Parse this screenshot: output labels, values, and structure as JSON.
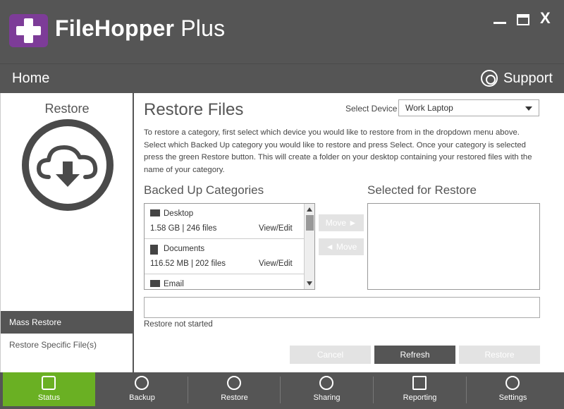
{
  "window": {
    "app_name_bold": "FileHopper",
    "app_name_plus": " Plus",
    "minimize_icon": "minimize-icon",
    "maximize_icon": "maximize-icon",
    "close_label": "X"
  },
  "nav": {
    "home": "Home",
    "support": "Support"
  },
  "sidebar": {
    "title": "Restore",
    "icon": "cloud-download-icon",
    "items": [
      {
        "label": "Mass Restore",
        "active": true
      },
      {
        "label": "Restore Specific File(s)",
        "active": false
      }
    ]
  },
  "main": {
    "title": "Restore Files",
    "device_label": "Select Device",
    "device_value": "Work Laptop",
    "instructions": "To restore a category, first select which device you would like to restore from in the dropdown menu above. Select which Backed Up category you would like to restore and press Select. Once your category is selected press the green Restore button. This will create a folder on your desktop containing your restored files with the name of your category.",
    "backed_up_heading": "Backed Up Categories",
    "selected_heading": "Selected for Restore",
    "categories": [
      {
        "name": "Desktop",
        "size": "1.58 GB | 246 files",
        "action": "View/Edit",
        "icon": "desktop-icon"
      },
      {
        "name": "Documents",
        "size": "116.52 MB | 202 files",
        "action": "View/Edit",
        "icon": "documents-icon"
      },
      {
        "name": "Email",
        "size": "",
        "action": "",
        "icon": "email-icon"
      }
    ],
    "move_right": "Move ►",
    "move_left": "◄ Move",
    "status": "Restore not started",
    "buttons": {
      "cancel": "Cancel",
      "refresh": "Refresh",
      "restore": "Restore"
    }
  },
  "tabs": [
    {
      "label": "Status",
      "icon": "status-icon",
      "active": true
    },
    {
      "label": "Backup",
      "icon": "backup-icon",
      "active": false
    },
    {
      "label": "Restore",
      "icon": "restore-icon",
      "active": false
    },
    {
      "label": "Sharing",
      "icon": "sharing-icon",
      "active": false
    },
    {
      "label": "Reporting",
      "icon": "reporting-icon",
      "active": false
    },
    {
      "label": "Settings",
      "icon": "settings-icon",
      "active": false
    }
  ],
  "colors": {
    "header_bg": "#555555",
    "logo_purple": "#7d3c98",
    "active_tab_green": "#6ab023",
    "disabled_button": "#e3e3e3"
  }
}
